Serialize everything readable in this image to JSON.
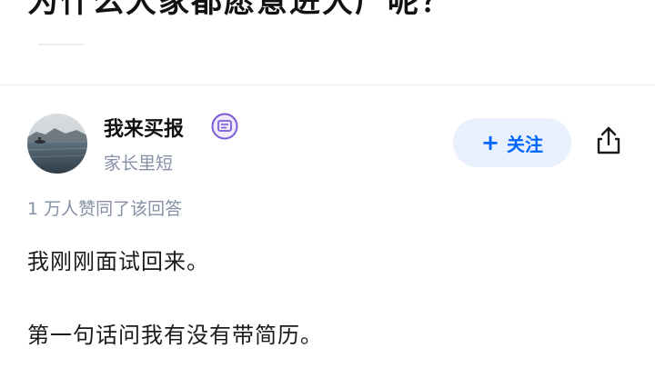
{
  "question": {
    "title": "为什么大家都愿意进大厂呢？"
  },
  "author": {
    "name": "我来买报",
    "description": "家长里短",
    "badge_icon": "message-badge-icon",
    "avatar_icon": "lake-landscape-avatar"
  },
  "actions": {
    "follow_label": "关注",
    "follow_icon": "plus-icon",
    "share_icon": "share-icon"
  },
  "answer": {
    "agree_text": "1 万人赞同了该回答",
    "paragraphs": [
      "我刚刚面试回来。",
      "第一句话问我有没有带简历。"
    ]
  },
  "colors": {
    "accent": "#0066ff",
    "follow_bg": "#e8f0fd",
    "meta_text": "#8590a6",
    "badge": "#7b5cd6"
  }
}
